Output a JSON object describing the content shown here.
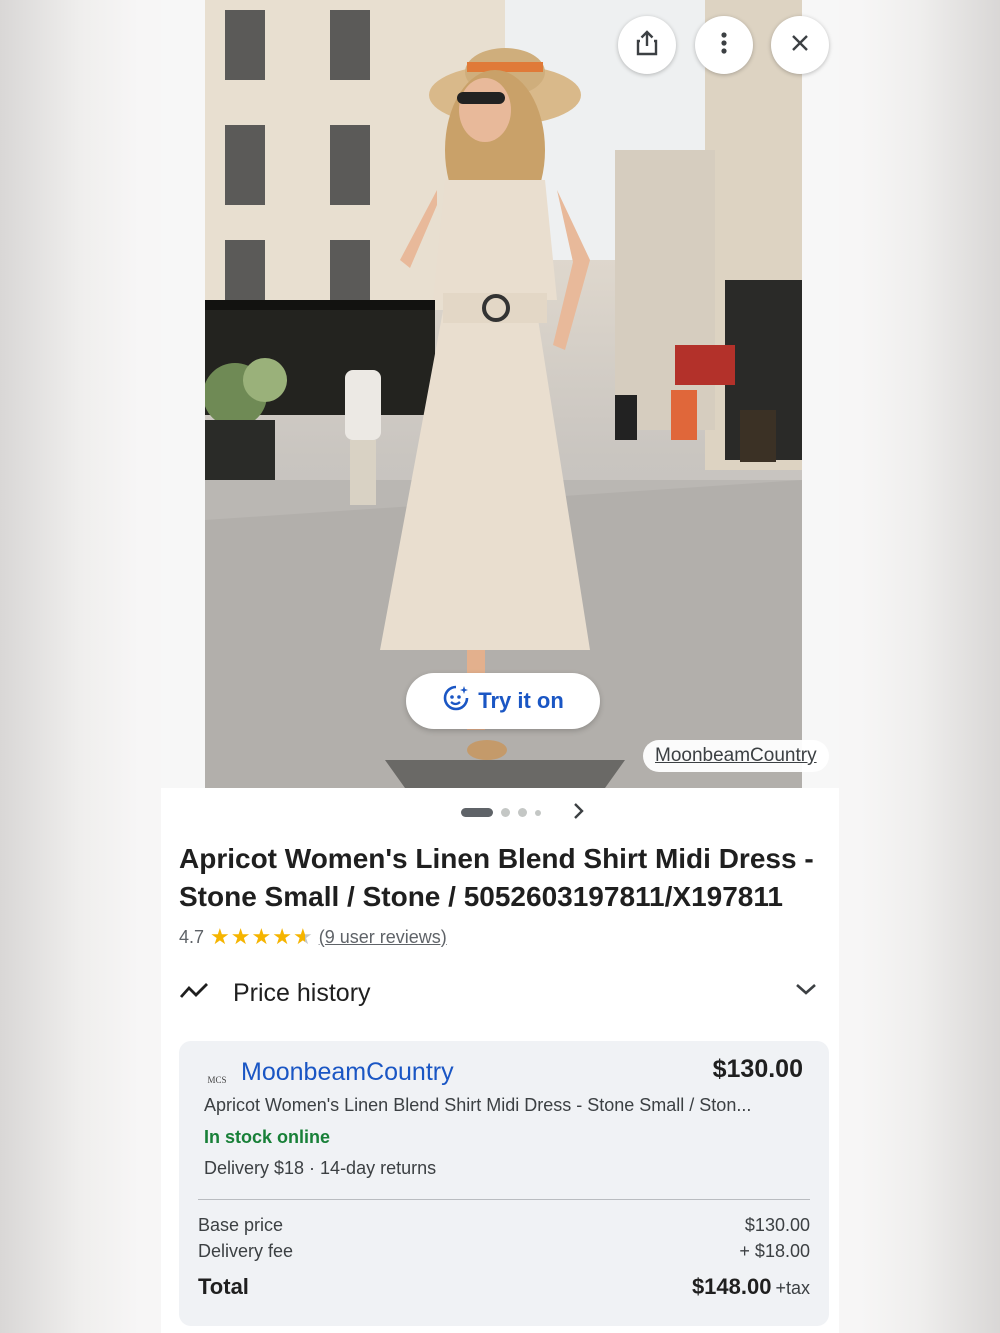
{
  "image": {
    "source_chip": "MoonbeamCountry",
    "try_on_label": "Try it on",
    "carousel": {
      "count": 4,
      "active_index": 0
    }
  },
  "toolbar": {
    "share_icon": "share-icon",
    "more_icon": "more-vert-icon",
    "close_icon": "close-icon"
  },
  "product": {
    "title": "Apricot Women's Linen Blend Shirt Midi Dress - Stone Small / Stone / 5052603197811/X197811",
    "rating_value": "4.7",
    "rating": 4.7,
    "reviews_label": "(9 user reviews)"
  },
  "price_history": {
    "label": "Price history"
  },
  "offer": {
    "merchant_logo_text": "MCS",
    "merchant": "MoonbeamCountry",
    "price": "$130.00",
    "description": "Apricot Women's Linen Blend Shirt Midi Dress - Stone Small / Ston...",
    "stock": "In stock online",
    "delivery": "Delivery $18 · 14-day returns",
    "base_price_label": "Base price",
    "base_price": "$130.00",
    "delivery_fee_label": "Delivery fee",
    "delivery_fee": "+ $18.00",
    "total_label": "Total",
    "total": "$148.00",
    "tax_label": "+tax"
  },
  "colors": {
    "link_blue": "#1a56c4",
    "stock_green": "#188038",
    "star": "#f5b400"
  }
}
